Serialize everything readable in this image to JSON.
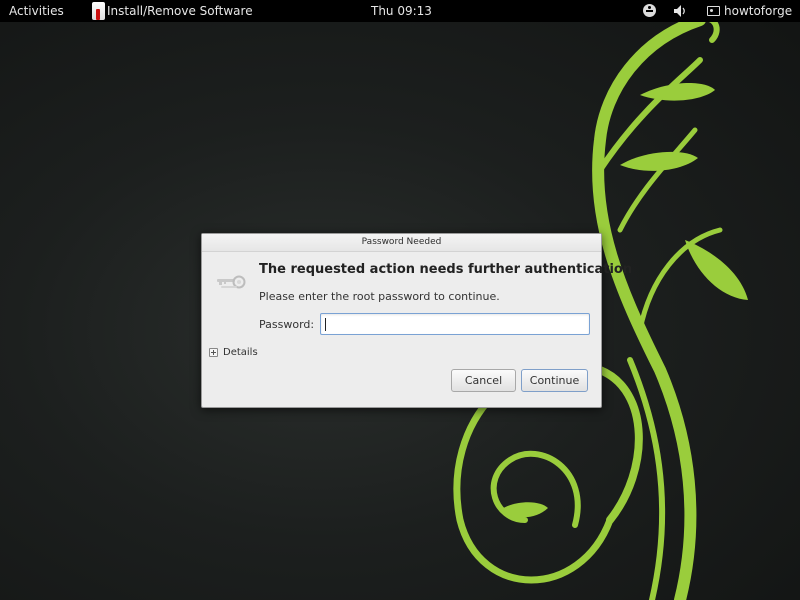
{
  "topbar": {
    "activities": "Activities",
    "app_name": "Install/Remove Software",
    "clock": "Thu 09:13",
    "user": "howtoforge",
    "icons": [
      "accessibility-icon",
      "volume-icon",
      "user-account-icon"
    ]
  },
  "dialog": {
    "title": "Password Needed",
    "heading": "The requested action needs further authentication",
    "message": "Please enter the root password to continue.",
    "password_label": "Password:",
    "password_value": "",
    "details_label": "Details",
    "cancel_label": "Cancel",
    "continue_label": "Continue",
    "icon": "keys-icon"
  },
  "colors": {
    "panel": "#000000",
    "desktop": "#1c1f1e",
    "swirl": "#9acd3c",
    "dialog_bg": "#ededed",
    "focus_border": "#7aa2d4"
  }
}
